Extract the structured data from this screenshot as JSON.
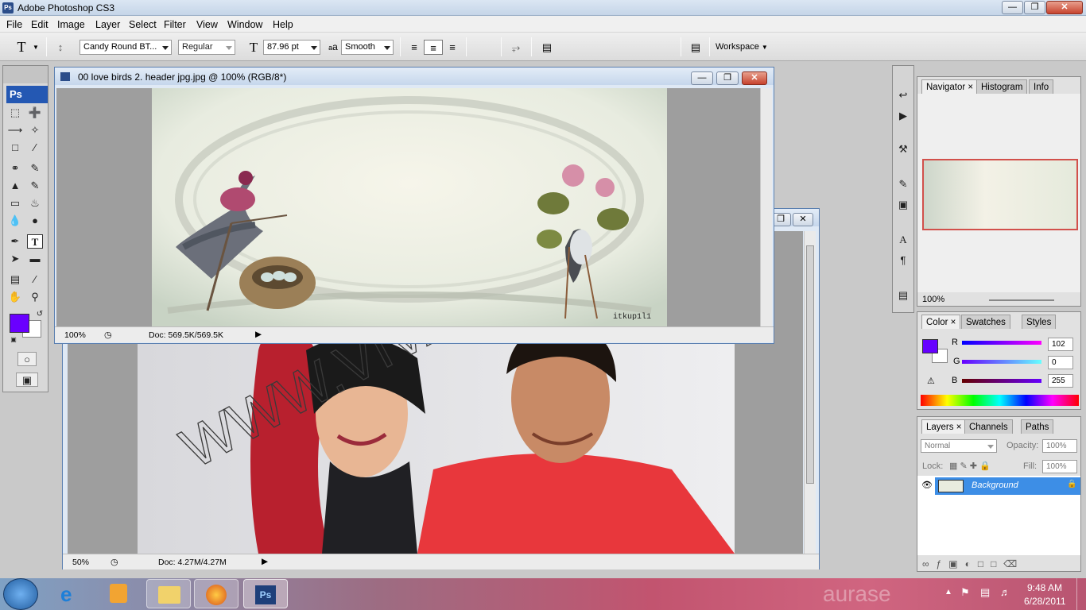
{
  "app": {
    "title": "Adobe Photoshop CS3",
    "icon_text": "Ps"
  },
  "menu": [
    "File",
    "Edit",
    "Image",
    "Layer",
    "Select",
    "Filter",
    "View",
    "Window",
    "Help"
  ],
  "options": {
    "tool_glyph": "T",
    "font_family": "Candy Round BT...",
    "font_style": "Regular",
    "font_size": "87.96 pt",
    "antialias_icon": "a",
    "antialias_icon_small": "a",
    "antialias": "Smooth",
    "workspace": "Workspace",
    "text_color": "#000000"
  },
  "toolbox": {
    "badge": "Ps",
    "foreground_color": "#6a00ff",
    "background_color": "#ffffff"
  },
  "doc1": {
    "title": "00 love birds 2. header jpg.jpg @ 100% (RGB/8*)",
    "zoom": "100%",
    "doc_size": "Doc: 569.5K/569.5K",
    "signature": "itkup1l1"
  },
  "doc2": {
    "zoom": "50%",
    "doc_size": "Doc: 4.27M/4.27M",
    "watermark": "WWW.VIVADEA.COM"
  },
  "navigator": {
    "tabs": [
      "Navigator",
      "Histogram",
      "Info"
    ],
    "zoom": "100%"
  },
  "color_panel": {
    "tabs": [
      "Color",
      "Swatches",
      "Styles"
    ],
    "r_label": "R",
    "g_label": "G",
    "b_label": "B",
    "r": "102",
    "g": "0",
    "b": "255",
    "color": "#6600ff"
  },
  "layers_panel": {
    "tabs": [
      "Layers",
      "Channels",
      "Paths"
    ],
    "blend_mode": "Normal",
    "opacity_label": "Opacity:",
    "opacity": "100%",
    "lock_label": "Lock:",
    "fill_label": "Fill:",
    "fill": "100%",
    "layer_name": "Background"
  },
  "taskbar": {
    "time": "9:48 AM",
    "date": "6/28/2011",
    "bg_text": "aurase",
    "ps_label": "Ps"
  }
}
